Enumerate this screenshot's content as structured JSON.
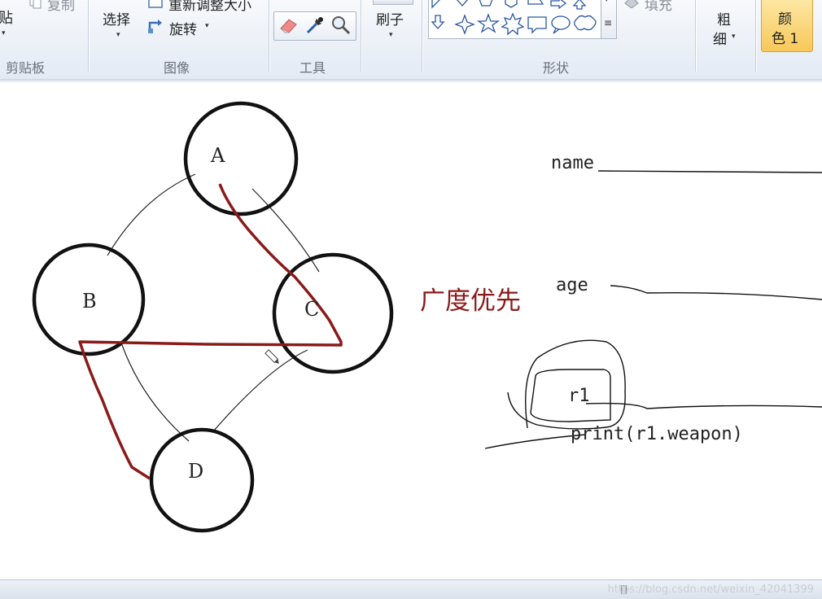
{
  "ribbon": {
    "clipboard": {
      "paste_partial": "贴",
      "copy_label": "复制",
      "group_label": "剪贴板"
    },
    "image": {
      "select_label": "选择",
      "resize_label": "重新调整大小",
      "rotate_label": "旋转",
      "group_label": "图像"
    },
    "tools": {
      "group_label": "工具",
      "icons": [
        "eraser-icon",
        "color-picker-icon",
        "magnifier-icon"
      ]
    },
    "brushes": {
      "label": "刷子"
    },
    "shapes": {
      "group_label": "形状",
      "fill_label": "填充"
    },
    "size": {
      "label_line1": "粗",
      "label_line2": "细"
    },
    "color1": {
      "label_line1": "颜",
      "label_line2": "色 1",
      "accent": "#f7c85a"
    }
  },
  "canvas": {
    "nodes": {
      "a": "A",
      "b": "B",
      "c": "C",
      "d": "D"
    },
    "annotation": "广度优先",
    "annotation_color": "#8b1a1a",
    "path_color": "#8b1a1a",
    "fields": {
      "name": "name",
      "age": "age",
      "r1": "r1",
      "print": "print(r1.weapon)"
    }
  },
  "statusbar": {
    "watermark": "https://blog.csdn.net/weixin_42041399"
  }
}
